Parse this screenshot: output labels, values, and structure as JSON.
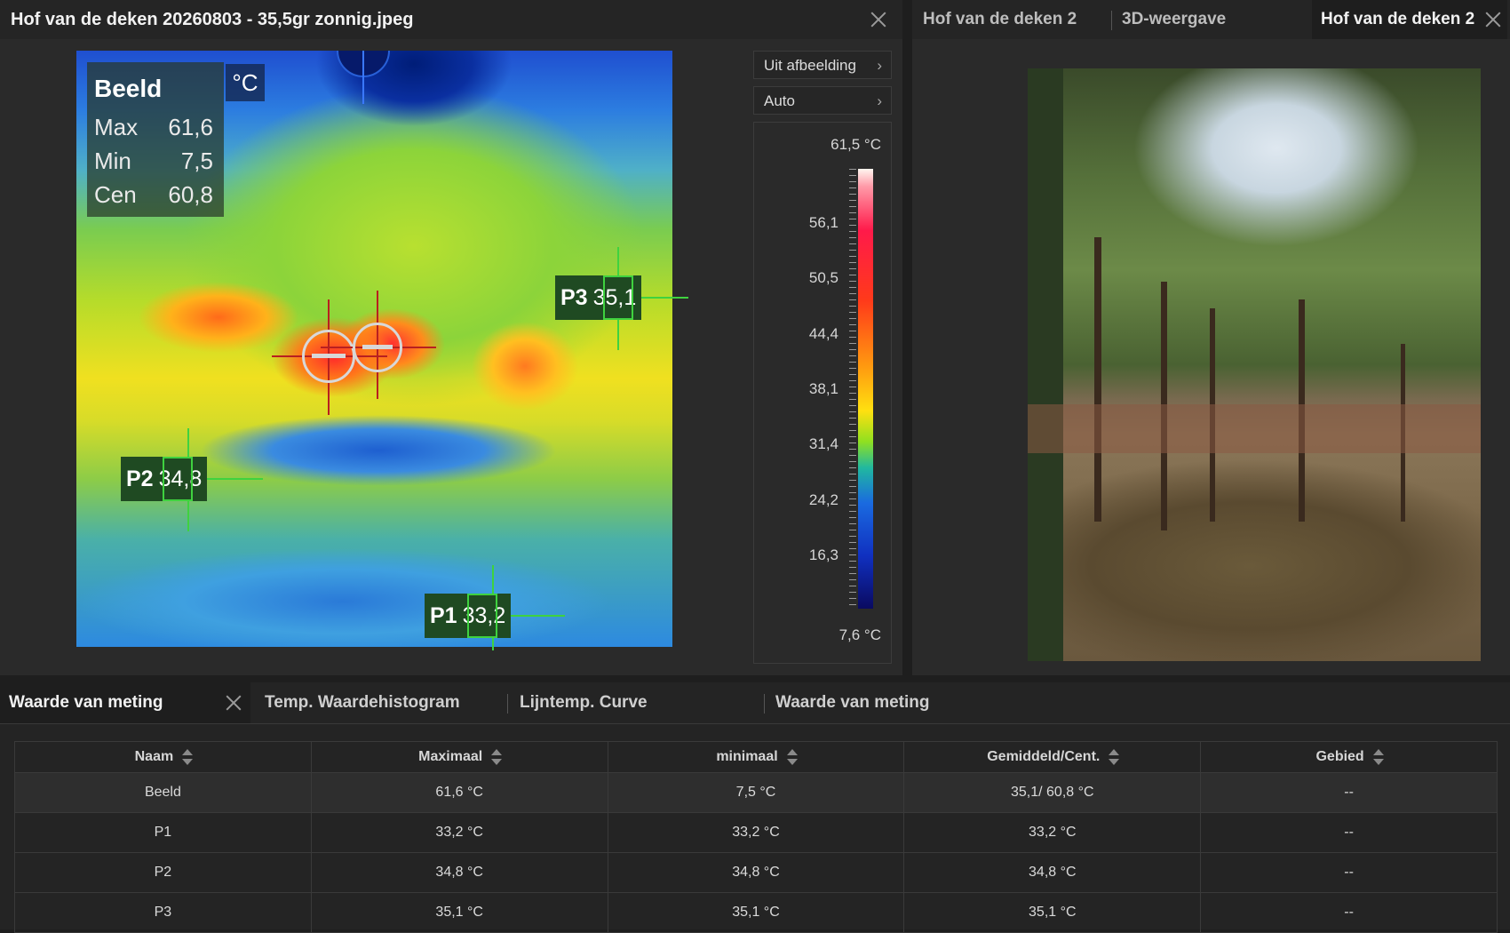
{
  "left_panel": {
    "title": "Hof van de deken 20260803 - 35,5gr zonnig.jpeg",
    "info": {
      "title": "Beeld",
      "unit": "°C",
      "rows": [
        {
          "label": "Max",
          "value": "61,6"
        },
        {
          "label": "Min",
          "value": "7,5"
        },
        {
          "label": "Cen",
          "value": "60,8"
        }
      ]
    },
    "markers": {
      "p1": {
        "name": "P1",
        "value": "33,2"
      },
      "p2": {
        "name": "P2",
        "value": "34,8"
      },
      "p3": {
        "name": "P3",
        "value": "35,1"
      }
    },
    "dropdowns": {
      "source": "Uit afbeelding",
      "range": "Auto"
    },
    "scale": {
      "max": "61,5 °C",
      "min": "7,6 °C",
      "ticks": [
        "56,1",
        "50,5",
        "44,4",
        "38,1",
        "31,4",
        "24,2",
        "16,3"
      ]
    }
  },
  "right_panel": {
    "tabs": [
      "Hof van de deken 2",
      "3D-weergave",
      "Hof van de deken 2"
    ]
  },
  "bottom_panel": {
    "tabs": [
      "Waarde van meting",
      "Temp. Waardehistogram",
      "Lijntemp. Curve",
      "Waarde van meting"
    ],
    "table": {
      "headers": [
        "Naam",
        "Maximaal",
        "minimaal",
        "Gemiddeld/Cent.",
        "Gebied"
      ],
      "rows": [
        [
          "Beeld",
          "61,6 °C",
          "7,5 °C",
          "35,1/ 60,8 °C",
          "--"
        ],
        [
          "P1",
          "33,2 °C",
          "33,2 °C",
          "33,2 °C",
          "--"
        ],
        [
          "P2",
          "34,8 °C",
          "34,8 °C",
          "34,8 °C",
          "--"
        ],
        [
          "P3",
          "35,1 °C",
          "35,1 °C",
          "35,1 °C",
          "--"
        ]
      ]
    }
  }
}
